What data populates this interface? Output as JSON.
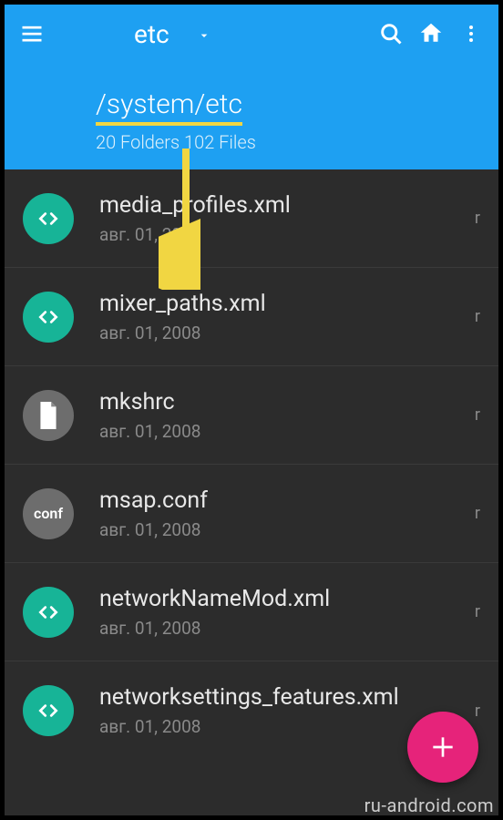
{
  "header": {
    "title": "etc",
    "path": "/system/etc",
    "subtitle": "20 Folders 102 Files"
  },
  "colors": {
    "accent": "#1ea0f2",
    "teal": "#17b497",
    "fab": "#e6237a"
  },
  "files": [
    {
      "name": "media_profiles.xml",
      "date": "авг. 01, 2008",
      "perm": "r",
      "icon": "code",
      "icon_bg": "teal"
    },
    {
      "name": "mixer_paths.xml",
      "date": "авг. 01, 2008",
      "perm": "r",
      "icon": "code",
      "icon_bg": "teal"
    },
    {
      "name": "mkshrc",
      "date": "авг. 01, 2008",
      "perm": "r",
      "icon": "doc",
      "icon_bg": "gray"
    },
    {
      "name": "msap.conf",
      "date": "авг. 01, 2008",
      "perm": "r",
      "icon": "conf",
      "icon_bg": "gray"
    },
    {
      "name": "networkNameMod.xml",
      "date": "авг. 01, 2008",
      "perm": "r",
      "icon": "code",
      "icon_bg": "teal"
    },
    {
      "name": "networksettings_features.xml",
      "date": "авг. 01, 2008",
      "perm": "r",
      "icon": "code",
      "icon_bg": "teal"
    }
  ],
  "watermark": "ru-android.com"
}
